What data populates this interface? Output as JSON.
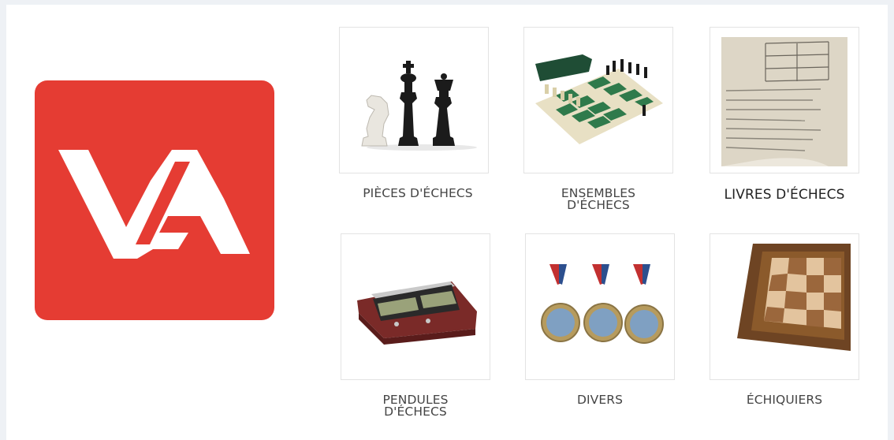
{
  "brand": {
    "logo_text": "VA",
    "color": "#e53c33"
  },
  "categories": [
    {
      "id": "pieces",
      "lines": [
        "PIÈCES D'ÉCHECS"
      ],
      "icon": "chess-pieces-icon"
    },
    {
      "id": "ensembles",
      "lines": [
        "ENSEMBLES",
        "D'ÉCHECS"
      ],
      "icon": "chess-set-icon"
    },
    {
      "id": "livres",
      "lines": [
        "LIVRES D'ÉCHECS"
      ],
      "icon": "chess-book-icon"
    },
    {
      "id": "pendules",
      "lines": [
        "PENDULES",
        "D'ÉCHECS"
      ],
      "icon": "chess-clock-icon"
    },
    {
      "id": "divers",
      "lines": [
        "DIVERS"
      ],
      "icon": "medals-icon"
    },
    {
      "id": "echiquiers",
      "lines": [
        "ÉCHIQUIERS"
      ],
      "icon": "chessboard-icon"
    }
  ]
}
